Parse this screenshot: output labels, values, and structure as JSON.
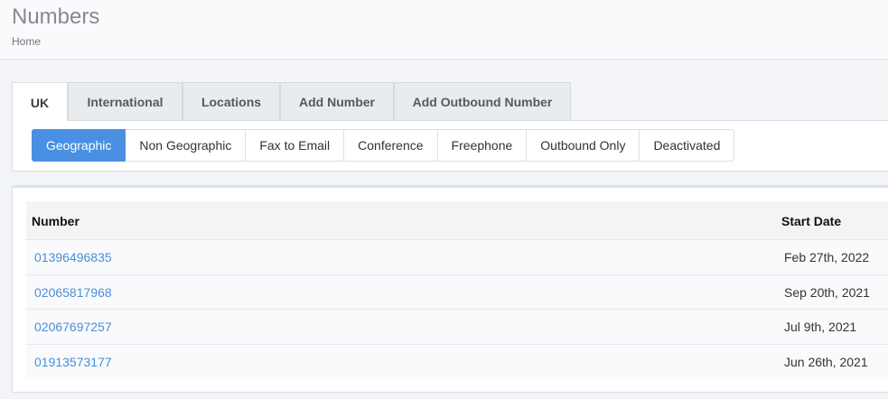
{
  "header": {
    "title": "Numbers",
    "breadcrumb": "Home"
  },
  "tabs": [
    {
      "label": "UK",
      "active": true
    },
    {
      "label": "International",
      "active": false
    },
    {
      "label": "Locations",
      "active": false
    },
    {
      "label": "Add Number",
      "active": false
    },
    {
      "label": "Add Outbound Number",
      "active": false
    }
  ],
  "subtabs": [
    {
      "label": "Geographic",
      "active": true
    },
    {
      "label": "Non Geographic",
      "active": false
    },
    {
      "label": "Fax to Email",
      "active": false
    },
    {
      "label": "Conference",
      "active": false
    },
    {
      "label": "Freephone",
      "active": false
    },
    {
      "label": "Outbound Only",
      "active": false
    },
    {
      "label": "Deactivated",
      "active": false
    }
  ],
  "table": {
    "columns": [
      "Number",
      "Start Date"
    ],
    "rows": [
      {
        "number": "01396496835",
        "start_date": "Feb 27th, 2022"
      },
      {
        "number": "02065817968",
        "start_date": "Sep 20th, 2021"
      },
      {
        "number": "02067697257",
        "start_date": "Jul 9th, 2021"
      },
      {
        "number": "01913573177",
        "start_date": "Jun 26th, 2021"
      }
    ]
  },
  "colors": {
    "accent": "#4a90e2",
    "link": "#4a8fd9"
  }
}
